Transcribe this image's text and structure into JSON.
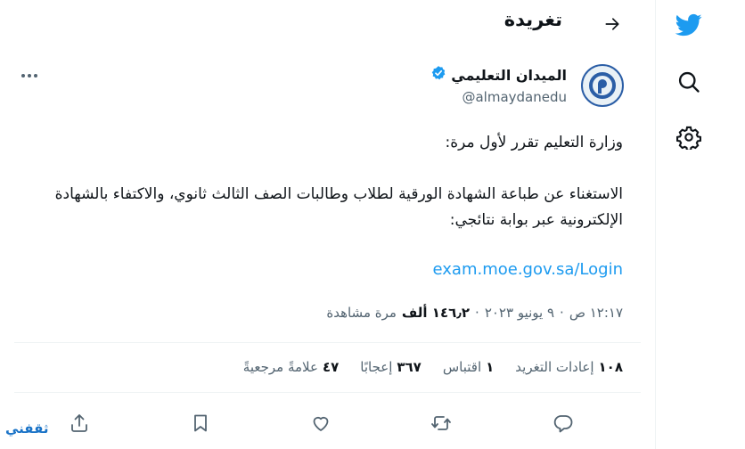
{
  "header": {
    "title": "تغريدة"
  },
  "author": {
    "name": "الميدان التعليمي",
    "handle": "@almaydanedu"
  },
  "tweet": {
    "line1": "وزارة التعليم تقرر لأول مرة:",
    "line2": "الاستغناء عن طباعة الشهادة الورقية لطلاب وطالبات الصف الثالث ثانوي، والاكتفاء بالشهادة الإلكترونية عبر بوابة نتائجي:",
    "link": "exam.moe.gov.sa/Login"
  },
  "meta": {
    "time": "١٢:١٧ ص",
    "sep": "·",
    "date": "٩ يونيو ٢٠٢٣",
    "views_count": "١٤٦٫٢ ألف",
    "views_label": "مرة مشاهدة"
  },
  "stats": {
    "retweets_count": "١٠٨",
    "retweets_label": "إعادات التغريد",
    "quotes_count": "١",
    "quotes_label": "اقتباس",
    "likes_count": "٣٦٧",
    "likes_label": "إعجابًا",
    "bookmarks_count": "٤٧",
    "bookmarks_label": "علامةً مرجعيةً"
  },
  "watermark": "ثقفني",
  "colors": {
    "accent": "#1d9bf0",
    "text": "#0f1419",
    "muted": "#536471"
  }
}
